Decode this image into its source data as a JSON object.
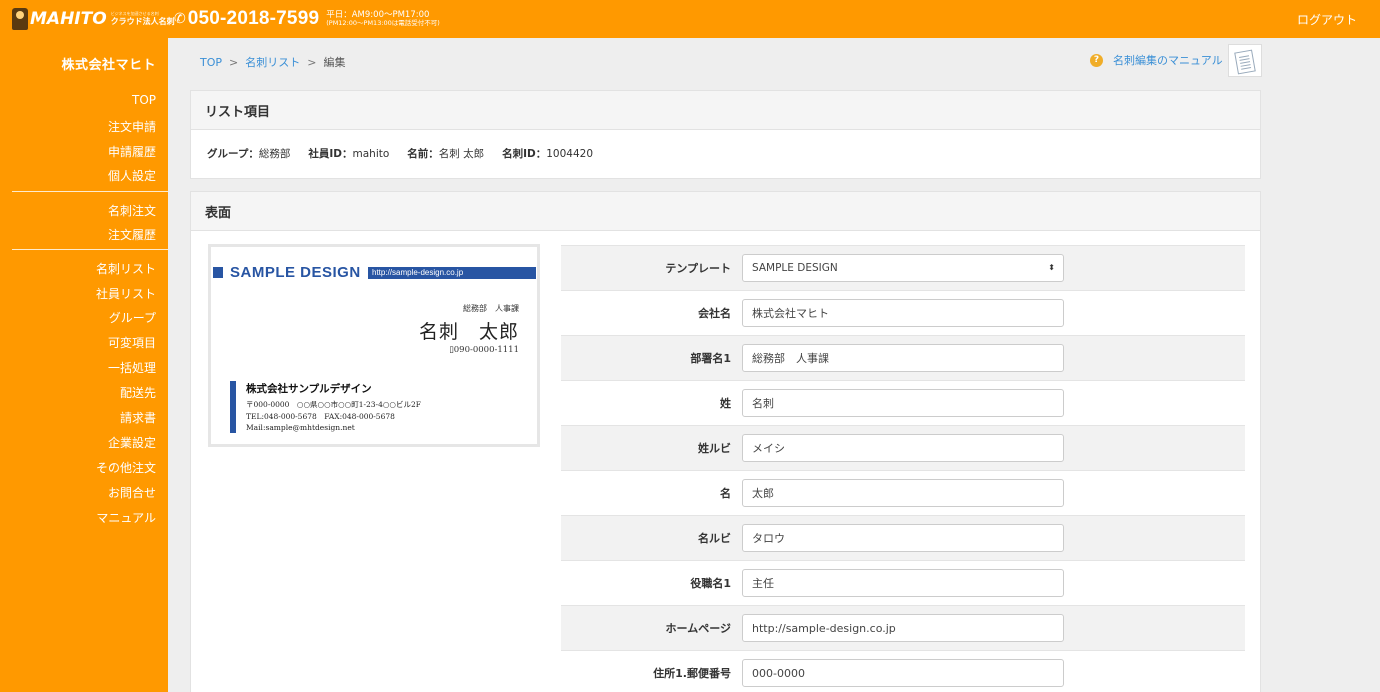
{
  "header": {
    "logo_text": "MAHITO",
    "logo_tagline": "ビジネスを加速させる名刺",
    "logo_subtitle": "クラウド法人名刺",
    "phone_icon": "phone-icon",
    "phone_number": "050-2018-7599",
    "hours_line1": "平日：AM9:00～PM17:00",
    "hours_line2": "(PM12:00～PM13:00は電話受付不可)",
    "logout_label": "ログアウト"
  },
  "sidebar": {
    "company": "株式会社マヒト",
    "group1": [
      "TOP",
      "注文申請",
      "申請履歴",
      "個人設定"
    ],
    "group2": [
      "名刺注文",
      "注文履歴"
    ],
    "group3": [
      "名刺リスト",
      "社員リスト",
      "グループ",
      "可変項目",
      "一括処理",
      "配送先",
      "請求書",
      "企業設定",
      "その他注文",
      "お問合せ",
      "マニュアル"
    ]
  },
  "breadcrumb": {
    "top": "TOP",
    "list": "名刺リスト",
    "current": "編集",
    "separator": ">"
  },
  "manual": {
    "label": "名刺編集のマニュアル",
    "help_icon": "?"
  },
  "list_panel": {
    "title": "リスト項目",
    "group_key": "グループ：",
    "group_val": "総務部",
    "emp_key": "社員ID：",
    "emp_val": "mahito",
    "name_key": "名前：",
    "name_val": "名刺 太郎",
    "card_key": "名刺ID：",
    "card_val": "1004420"
  },
  "front_panel": {
    "title": "表面"
  },
  "card_preview": {
    "title": "SAMPLE DESIGN",
    "url": "http://sample-design.co.jp",
    "dept": "総務部　人事課",
    "name": "名刺　太郎",
    "phone": "▯090-0000-1111",
    "company": "株式会社サンプルデザイン",
    "address": "〒000-0000　○○県○○市○○町1-23-4○○ビル2F",
    "tel_fax": "TEL:048-000-5678　FAX:048-000-5678",
    "mail": "Mail:sample@mhtdesign.net",
    "accent_color": "#2855a3"
  },
  "form": {
    "template_label": "テンプレート",
    "template_value": "SAMPLE DESIGN",
    "fields": [
      {
        "label": "会社名",
        "value": "株式会社マヒト"
      },
      {
        "label": "部署名1",
        "value": "総務部　人事課"
      },
      {
        "label": "姓",
        "value": "名刺"
      },
      {
        "label": "姓ルビ",
        "value": "メイシ"
      },
      {
        "label": "名",
        "value": "太郎"
      },
      {
        "label": "名ルビ",
        "value": "タロウ"
      },
      {
        "label": "役職名1",
        "value": "主任"
      },
      {
        "label": "ホームページ",
        "value": "http://sample-design.co.jp"
      },
      {
        "label": "住所1.郵便番号",
        "value": "000-0000"
      }
    ]
  },
  "colors": {
    "brand": "#ff9900",
    "link": "#3a8fd6"
  }
}
